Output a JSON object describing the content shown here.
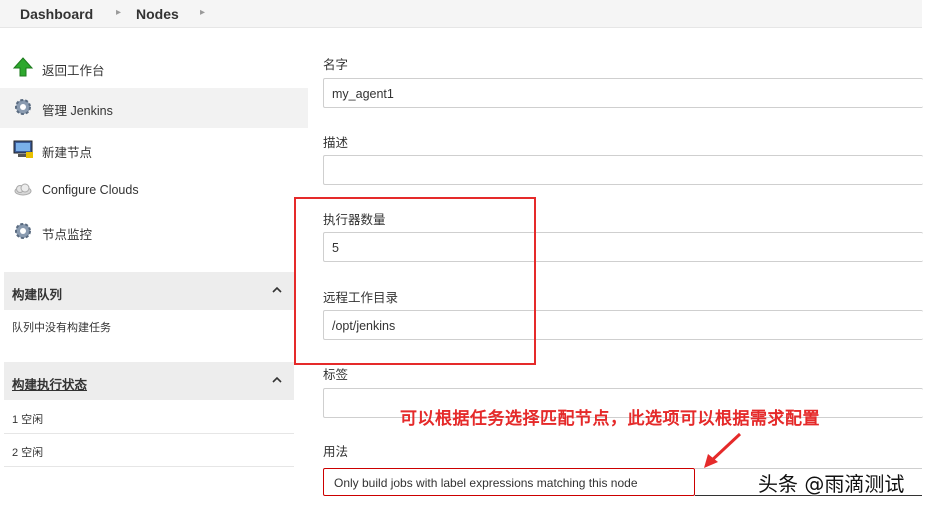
{
  "breadcrumb": {
    "items": [
      "Dashboard",
      "Nodes"
    ]
  },
  "sidebar": {
    "tasks": [
      {
        "label": "返回工作台",
        "icon": "up-arrow-icon"
      },
      {
        "label": "管理 Jenkins",
        "icon": "gear-icon"
      },
      {
        "label": "新建节点",
        "icon": "computer-icon"
      },
      {
        "label": "Configure Clouds",
        "icon": "cloud-icon"
      },
      {
        "label": "节点监控",
        "icon": "gear-icon"
      }
    ],
    "build_queue": {
      "title": "构建队列",
      "empty_text": "队列中没有构建任务"
    },
    "executors": {
      "title": "构建执行状态",
      "rows": [
        "1  空闲",
        "2  空闲"
      ]
    }
  },
  "form": {
    "name": {
      "label": "名字",
      "value": "my_agent1"
    },
    "description": {
      "label": "描述",
      "value": ""
    },
    "executors": {
      "label": "执行器数量",
      "value": "5"
    },
    "remote_dir": {
      "label": "远程工作目录",
      "value": "/opt/jenkins"
    },
    "labels": {
      "label": "标签",
      "value": ""
    },
    "usage": {
      "label": "用法",
      "selected": "Only build jobs with label expressions matching this node"
    }
  },
  "annotation": {
    "text": "可以根据任务选择匹配节点，此选项可以根据需求配置",
    "color": "#e52a2a"
  },
  "watermark": {
    "text": "头条 @雨滴测试"
  }
}
